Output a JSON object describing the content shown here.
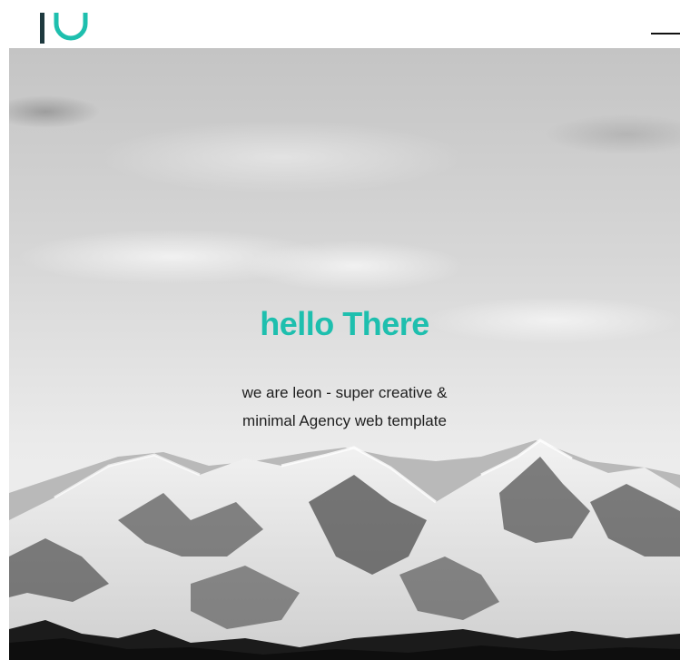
{
  "brand": {
    "logo_icon": "leon-logo-icon",
    "accent_color": "#1ebfae",
    "dark_color": "#1e3a3f"
  },
  "header": {
    "menu_icon": "hamburger-menu-icon"
  },
  "hero": {
    "title": "hello There",
    "subtitle_line1": "we are leon - super creative &",
    "subtitle_line2": "minimal Agency web template",
    "background": "snowy-mountains-photo"
  }
}
